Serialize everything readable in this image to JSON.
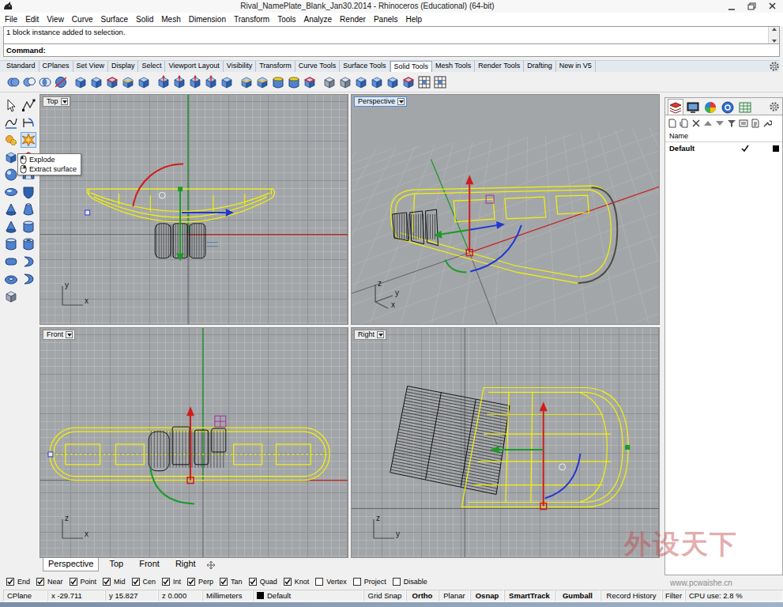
{
  "window": {
    "title": "Rival_NamePlate_Blank_Jan30.2014 - Rhinoceros (Educational) (64-bit)"
  },
  "menu": [
    "File",
    "Edit",
    "View",
    "Curve",
    "Surface",
    "Solid",
    "Mesh",
    "Dimension",
    "Transform",
    "Tools",
    "Analyze",
    "Render",
    "Panels",
    "Help"
  ],
  "command": {
    "history": "1 block instance added to selection.",
    "prompt": "Command:"
  },
  "toolbar_tabs": [
    {
      "label": "Standard",
      "selected": false
    },
    {
      "label": "CPlanes",
      "selected": false
    },
    {
      "label": "Set View",
      "selected": false
    },
    {
      "label": "Display",
      "selected": false
    },
    {
      "label": "Select",
      "selected": false
    },
    {
      "label": "Viewport Layout",
      "selected": false
    },
    {
      "label": "Visibility",
      "selected": false
    },
    {
      "label": "Transform",
      "selected": false
    },
    {
      "label": "Curve Tools",
      "selected": false
    },
    {
      "label": "Surface Tools",
      "selected": false
    },
    {
      "label": "Solid Tools",
      "selected": true
    },
    {
      "label": "Mesh Tools",
      "selected": false
    },
    {
      "label": "Render Tools",
      "selected": false
    },
    {
      "label": "Drafting",
      "selected": false
    },
    {
      "label": "New in V5",
      "selected": false
    }
  ],
  "left_toolbar": [
    {
      "hovered": false
    },
    {
      "hovered": false
    },
    {
      "hovered": false
    },
    {
      "hovered": false
    },
    {
      "hovered": false
    },
    {
      "hovered": true
    },
    {
      "hovered": false
    },
    {
      "hovered": false
    },
    {
      "hovered": false
    },
    {
      "hovered": false
    },
    {
      "hovered": false
    },
    {
      "hovered": false
    },
    {
      "hovered": false
    },
    {
      "hovered": false
    },
    {
      "hovered": false
    },
    {
      "hovered": false
    },
    {
      "hovered": false
    },
    {
      "hovered": false
    },
    {
      "hovered": false
    },
    {
      "hovered": false
    },
    {
      "hovered": false
    },
    {
      "hovered": false
    },
    {
      "hovered": false
    }
  ],
  "tooltip": {
    "items": [
      "Explode",
      "Extract surface"
    ]
  },
  "viewports": [
    {
      "title": "Top",
      "active": false,
      "axes": [
        "y",
        "x"
      ]
    },
    {
      "title": "Perspective",
      "active": true,
      "axes": [
        "z",
        "y",
        "x"
      ]
    },
    {
      "title": "Front",
      "active": false,
      "axes": [
        "z",
        "x"
      ]
    },
    {
      "title": "Right",
      "active": false,
      "axes": [
        "z",
        "y"
      ]
    }
  ],
  "viewport_tabs": [
    {
      "label": "Perspective",
      "selected": true
    },
    {
      "label": "Top",
      "selected": false
    },
    {
      "label": "Front",
      "selected": false
    },
    {
      "label": "Right",
      "selected": false
    }
  ],
  "panel_tabs": [
    {
      "selected": true
    },
    {
      "selected": false
    },
    {
      "selected": false
    },
    {
      "selected": false
    },
    {
      "selected": false
    }
  ],
  "layers": {
    "header": "Name",
    "rows": [
      {
        "name": "Default",
        "current": true,
        "color": "#000000"
      }
    ]
  },
  "osnaps": [
    {
      "label": "End",
      "checked": true
    },
    {
      "label": "Near",
      "checked": true
    },
    {
      "label": "Point",
      "checked": true
    },
    {
      "label": "Mid",
      "checked": true
    },
    {
      "label": "Cen",
      "checked": true
    },
    {
      "label": "Int",
      "checked": true
    },
    {
      "label": "Perp",
      "checked": true
    },
    {
      "label": "Tan",
      "checked": true
    },
    {
      "label": "Quad",
      "checked": true
    },
    {
      "label": "Knot",
      "checked": true
    },
    {
      "label": "Vertex",
      "checked": false
    },
    {
      "label": "Project",
      "checked": false
    },
    {
      "label": "Disable",
      "checked": false
    }
  ],
  "status_bar": {
    "cplane": "CPlane",
    "x": "x -29.711",
    "y": "y 15.827",
    "z": "z 0.000",
    "units": "Millimeters",
    "layer": {
      "name": "Default",
      "color": "#000000"
    },
    "toggles": [
      {
        "label": "Grid Snap",
        "on": false
      },
      {
        "label": "Ortho",
        "on": true
      },
      {
        "label": "Planar",
        "on": false
      },
      {
        "label": "Osnap",
        "on": true
      },
      {
        "label": "SmartTrack",
        "on": true
      },
      {
        "label": "Gumball",
        "on": true
      },
      {
        "label": "Record History",
        "on": false
      },
      {
        "label": "Filter",
        "on": false
      }
    ],
    "cpu": "CPU use: 2.8 %"
  },
  "watermark": {
    "logo": "外设天下",
    "url": "www.pcwaishe.cn"
  }
}
